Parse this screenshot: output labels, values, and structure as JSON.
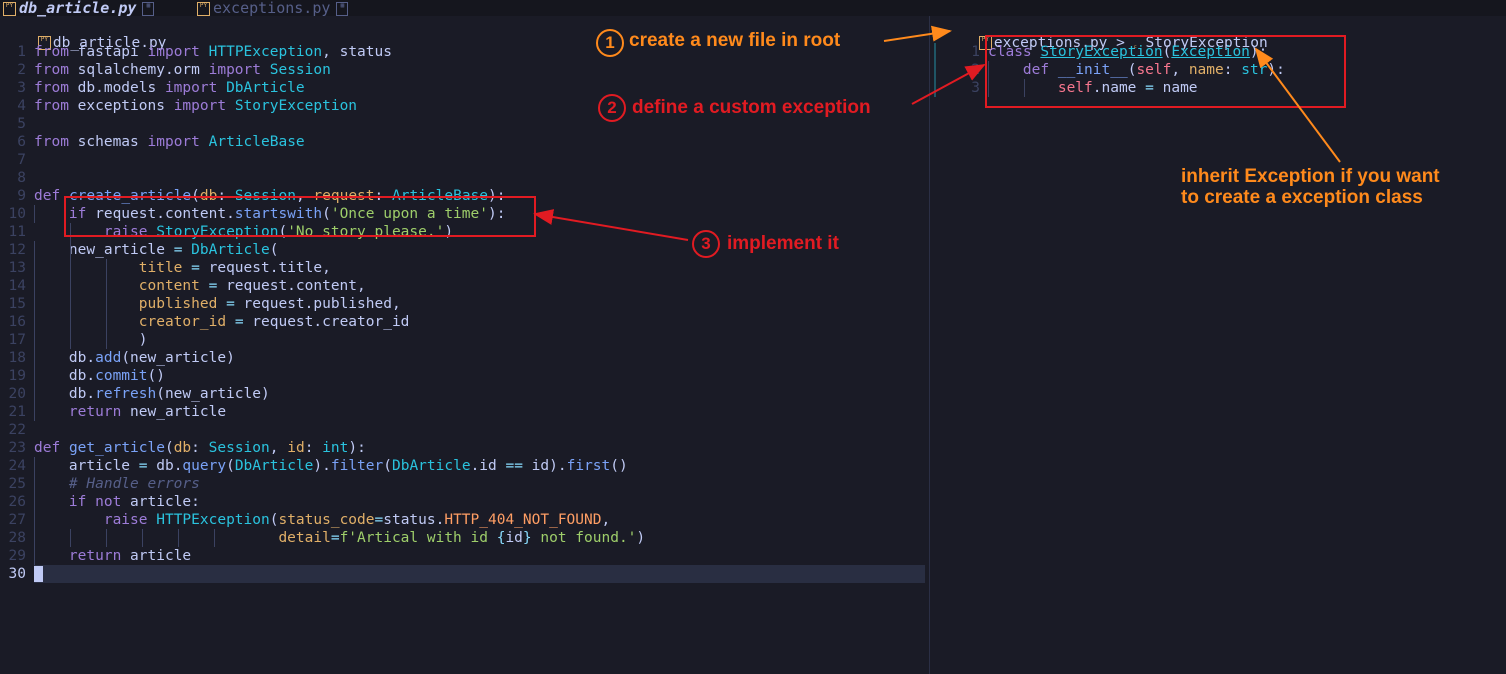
{
  "tabs": [
    {
      "icon": "python-file-icon",
      "name": "db_article.py",
      "active": true
    },
    {
      "icon": "python-file-icon",
      "name": "exceptions.py",
      "active": false
    }
  ],
  "left_editor": {
    "breadcrumb": "db_article.py",
    "lines": [
      {
        "n": "1",
        "html": "<span class='kw'>from</span> fastapi <span class='kw'>import</span> <span class='ty'>HTTPException</span>, status"
      },
      {
        "n": "2",
        "html": "<span class='kw'>from</span> sqlalchemy.orm <span class='kw'>import</span> <span class='ty'>Session</span>"
      },
      {
        "n": "3",
        "html": "<span class='kw'>from</span> db.models <span class='kw'>import</span> <span class='ty'>DbArticle</span>"
      },
      {
        "n": "4",
        "html": "<span class='kw'>from</span> exceptions <span class='kw'>import</span> <span class='ty'>StoryException</span>"
      },
      {
        "n": "5",
        "html": ""
      },
      {
        "n": "6",
        "html": "<span class='kw'>from</span> schemas <span class='kw'>import</span> <span class='ty'>ArticleBase</span>"
      },
      {
        "n": "7",
        "html": ""
      },
      {
        "n": "8",
        "html": ""
      },
      {
        "n": "9",
        "html": "<span class='kw'>def</span> <span class='fn'>create_article</span>(<span class='pa'>db</span>: <span class='ty'>Session</span>, <span class='pa'>request</span>: <span class='ty'>ArticleBase</span>):"
      },
      {
        "n": "10",
        "html": "    <span class='kw'>if</span> request.content.<span class='fn'>startswith</span>(<span class='st'>'Once upon a time'</span>):"
      },
      {
        "n": "11",
        "html": "        <span class='kw'>raise</span> <span class='ty'>StoryException</span>(<span class='st'>'No story please.'</span>)"
      },
      {
        "n": "12",
        "html": "    new_article <span class='op'>=</span> <span class='ty'>DbArticle</span>("
      },
      {
        "n": "13",
        "html": "            <span class='pa'>title</span> <span class='op'>=</span> request.title,"
      },
      {
        "n": "14",
        "html": "            <span class='pa'>content</span> <span class='op'>=</span> request.content,"
      },
      {
        "n": "15",
        "html": "            <span class='pa'>published</span> <span class='op'>=</span> request.published,"
      },
      {
        "n": "16",
        "html": "            <span class='pa'>creator_id</span> <span class='op'>=</span> request.creator_id"
      },
      {
        "n": "17",
        "html": "            )"
      },
      {
        "n": "18",
        "html": "    db.<span class='fn'>add</span>(new_article)"
      },
      {
        "n": "19",
        "html": "    db.<span class='fn'>commit</span>()"
      },
      {
        "n": "20",
        "html": "    db.<span class='fn'>refresh</span>(new_article)"
      },
      {
        "n": "21",
        "html": "    <span class='kw'>return</span> new_article"
      },
      {
        "n": "22",
        "html": ""
      },
      {
        "n": "23",
        "html": "<span class='kw'>def</span> <span class='fn'>get_article</span>(<span class='pa'>db</span>: <span class='ty'>Session</span>, <span class='pa'>id</span>: <span class='ty'>int</span>):"
      },
      {
        "n": "24",
        "html": "    article <span class='op'>=</span> db.<span class='fn'>query</span>(<span class='ty'>DbArticle</span>).<span class='fn'>filter</span>(<span class='ty'>DbArticle</span>.id <span class='op'>==</span> id).<span class='fn'>first</span>()"
      },
      {
        "n": "25",
        "html": "    <span class='cm'># Handle errors</span>"
      },
      {
        "n": "26",
        "html": "    <span class='kw'>if not</span> article:"
      },
      {
        "n": "27",
        "html": "        <span class='kw'>raise</span> <span class='ty'>HTTPException</span>(<span class='pa'>status_code</span><span class='op'>=</span>status.<span class='cn'>HTTP_404_NOT_FOUND</span>,"
      },
      {
        "n": "28",
        "html": "                            <span class='pa'>detail</span><span class='op'>=</span><span class='st'>f'Artical with id </span><span class='op'>{</span>id<span class='op'>}</span><span class='st'> not found.'</span>)"
      },
      {
        "n": "29",
        "html": "    <span class='kw'>return</span> article"
      },
      {
        "n": "30",
        "html": "",
        "current": true
      }
    ]
  },
  "right_editor": {
    "breadcrumb_file": "exceptions.py",
    "breadcrumb_sep": ">",
    "breadcrumb_symbol_icon": "class-symbol-icon",
    "breadcrumb_symbol": "StoryException",
    "lines": [
      {
        "n": "1",
        "html": "<span class='kw'>class</span> <span class='ty ul'>StoryException</span>(<span class='ty ul'>Exception</span>):"
      },
      {
        "n": "2",
        "html": "    <span class='kw'>def</span> <span class='fn'>__init__</span>(<span class='sl'>self</span>, <span class='pa'>name</span>: <span class='ty'>str</span>):"
      },
      {
        "n": "3",
        "html": "        <span class='sl'>self</span>.name <span class='op'>=</span> name"
      }
    ]
  },
  "annotations": {
    "a1": {
      "number": "1",
      "text": "create a new file in root",
      "color": "#ff8a1c"
    },
    "a2": {
      "number": "2",
      "text": "define a custom exception",
      "color": "#e11b22"
    },
    "a3": {
      "number": "3",
      "text": "implement it",
      "color": "#e11b22"
    },
    "a4": {
      "line1": "inherit Exception if you want",
      "line2": "to create a exception class",
      "color": "#ff8a1c"
    }
  },
  "theme": {
    "background": "#1a1b26",
    "accent_orange": "#ff8a1c",
    "accent_red": "#e11b22"
  }
}
